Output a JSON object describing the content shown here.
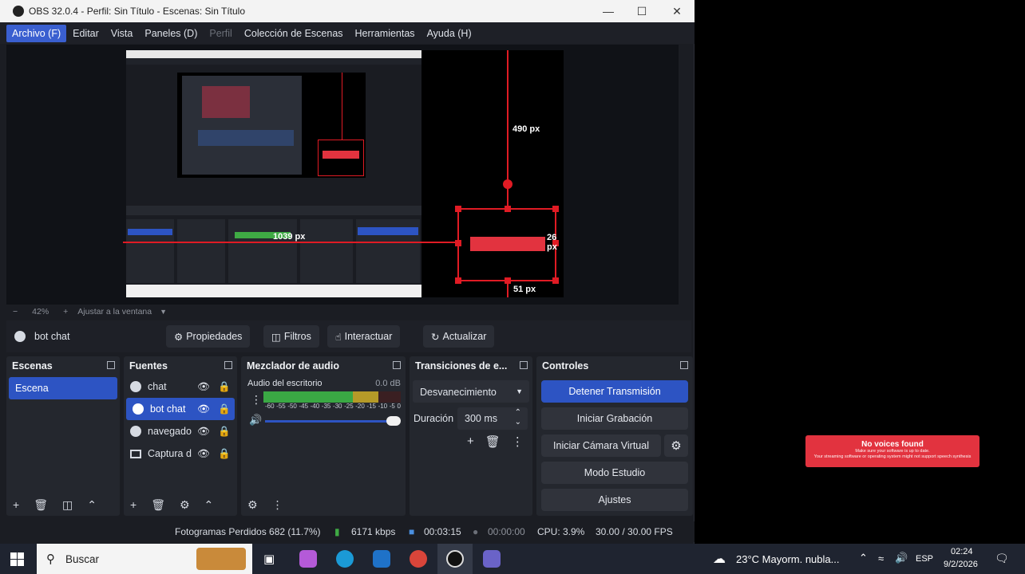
{
  "window": {
    "title": "OBS 32.0.4 - Perfil: Sin Título - Escenas: Sin Título"
  },
  "menu": [
    {
      "label": "Archivo (F)",
      "state": "active"
    },
    {
      "label": "Editar"
    },
    {
      "label": "Vista"
    },
    {
      "label": "Paneles (D)"
    },
    {
      "label": "Perfil",
      "state": "disabled"
    },
    {
      "label": "Colección de Escenas"
    },
    {
      "label": "Herramientas"
    },
    {
      "label": "Ayuda (H)"
    }
  ],
  "preview": {
    "label_490": "490 px",
    "label_1039": "1039 px",
    "label_26": "26 px",
    "label_51": "51 px"
  },
  "zoom": {
    "minus": "−",
    "value": "42%",
    "plus": "+",
    "fit": "Ajustar a la ventana"
  },
  "source_bar": {
    "selected": "bot chat",
    "properties": "Propiedades",
    "filters": "Filtros",
    "interact": "Interactuar",
    "refresh": "Actualizar"
  },
  "scenes": {
    "title": "Escenas",
    "items": [
      "Escena"
    ]
  },
  "sources": {
    "title": "Fuentes",
    "items": [
      "chat",
      "bot chat",
      "navegado",
      "Captura d"
    ]
  },
  "audio": {
    "title": "Mezclador de audio",
    "channel": "Audio del escritorio",
    "level": "0.0 dB",
    "scale": [
      "-60",
      "-55",
      "-50",
      "-45",
      "-40",
      "-35",
      "-30",
      "-25",
      "-20",
      "-15",
      "-10",
      "-5",
      "0"
    ]
  },
  "transitions": {
    "title": "Transiciones de e...",
    "type": "Desvanecimiento",
    "duration_label": "Duración",
    "duration_value": "300 ms"
  },
  "controls": {
    "title": "Controles",
    "stop_stream": "Detener Transmisión",
    "start_record": "Iniciar Grabación",
    "virtual_cam": "Iniciar Cámara Virtual",
    "studio_mode": "Modo Estudio",
    "settings": "Ajustes"
  },
  "status": {
    "dropped": "Fotogramas Perdidos 682 (11.7%)",
    "bitrate": "6171 kbps",
    "stream_time": "00:03:15",
    "record_time": "00:00:00",
    "cpu": "CPU: 3.9%",
    "fps": "30.00 / 30.00 FPS"
  },
  "toast": {
    "title": "No voices found",
    "line1": "Make sure your software is up to date.",
    "line2": "Your streaming software or operating system might not support speech synthesis"
  },
  "taskbar": {
    "search": "Buscar",
    "weather": "23°C  Mayorm. nubla...",
    "lang": "ESP",
    "time": "02:24",
    "date": "9/2/2026"
  },
  "colors": {
    "accent": "#2d54c3",
    "marker": "#e01b24",
    "toast": "#e2333f"
  }
}
